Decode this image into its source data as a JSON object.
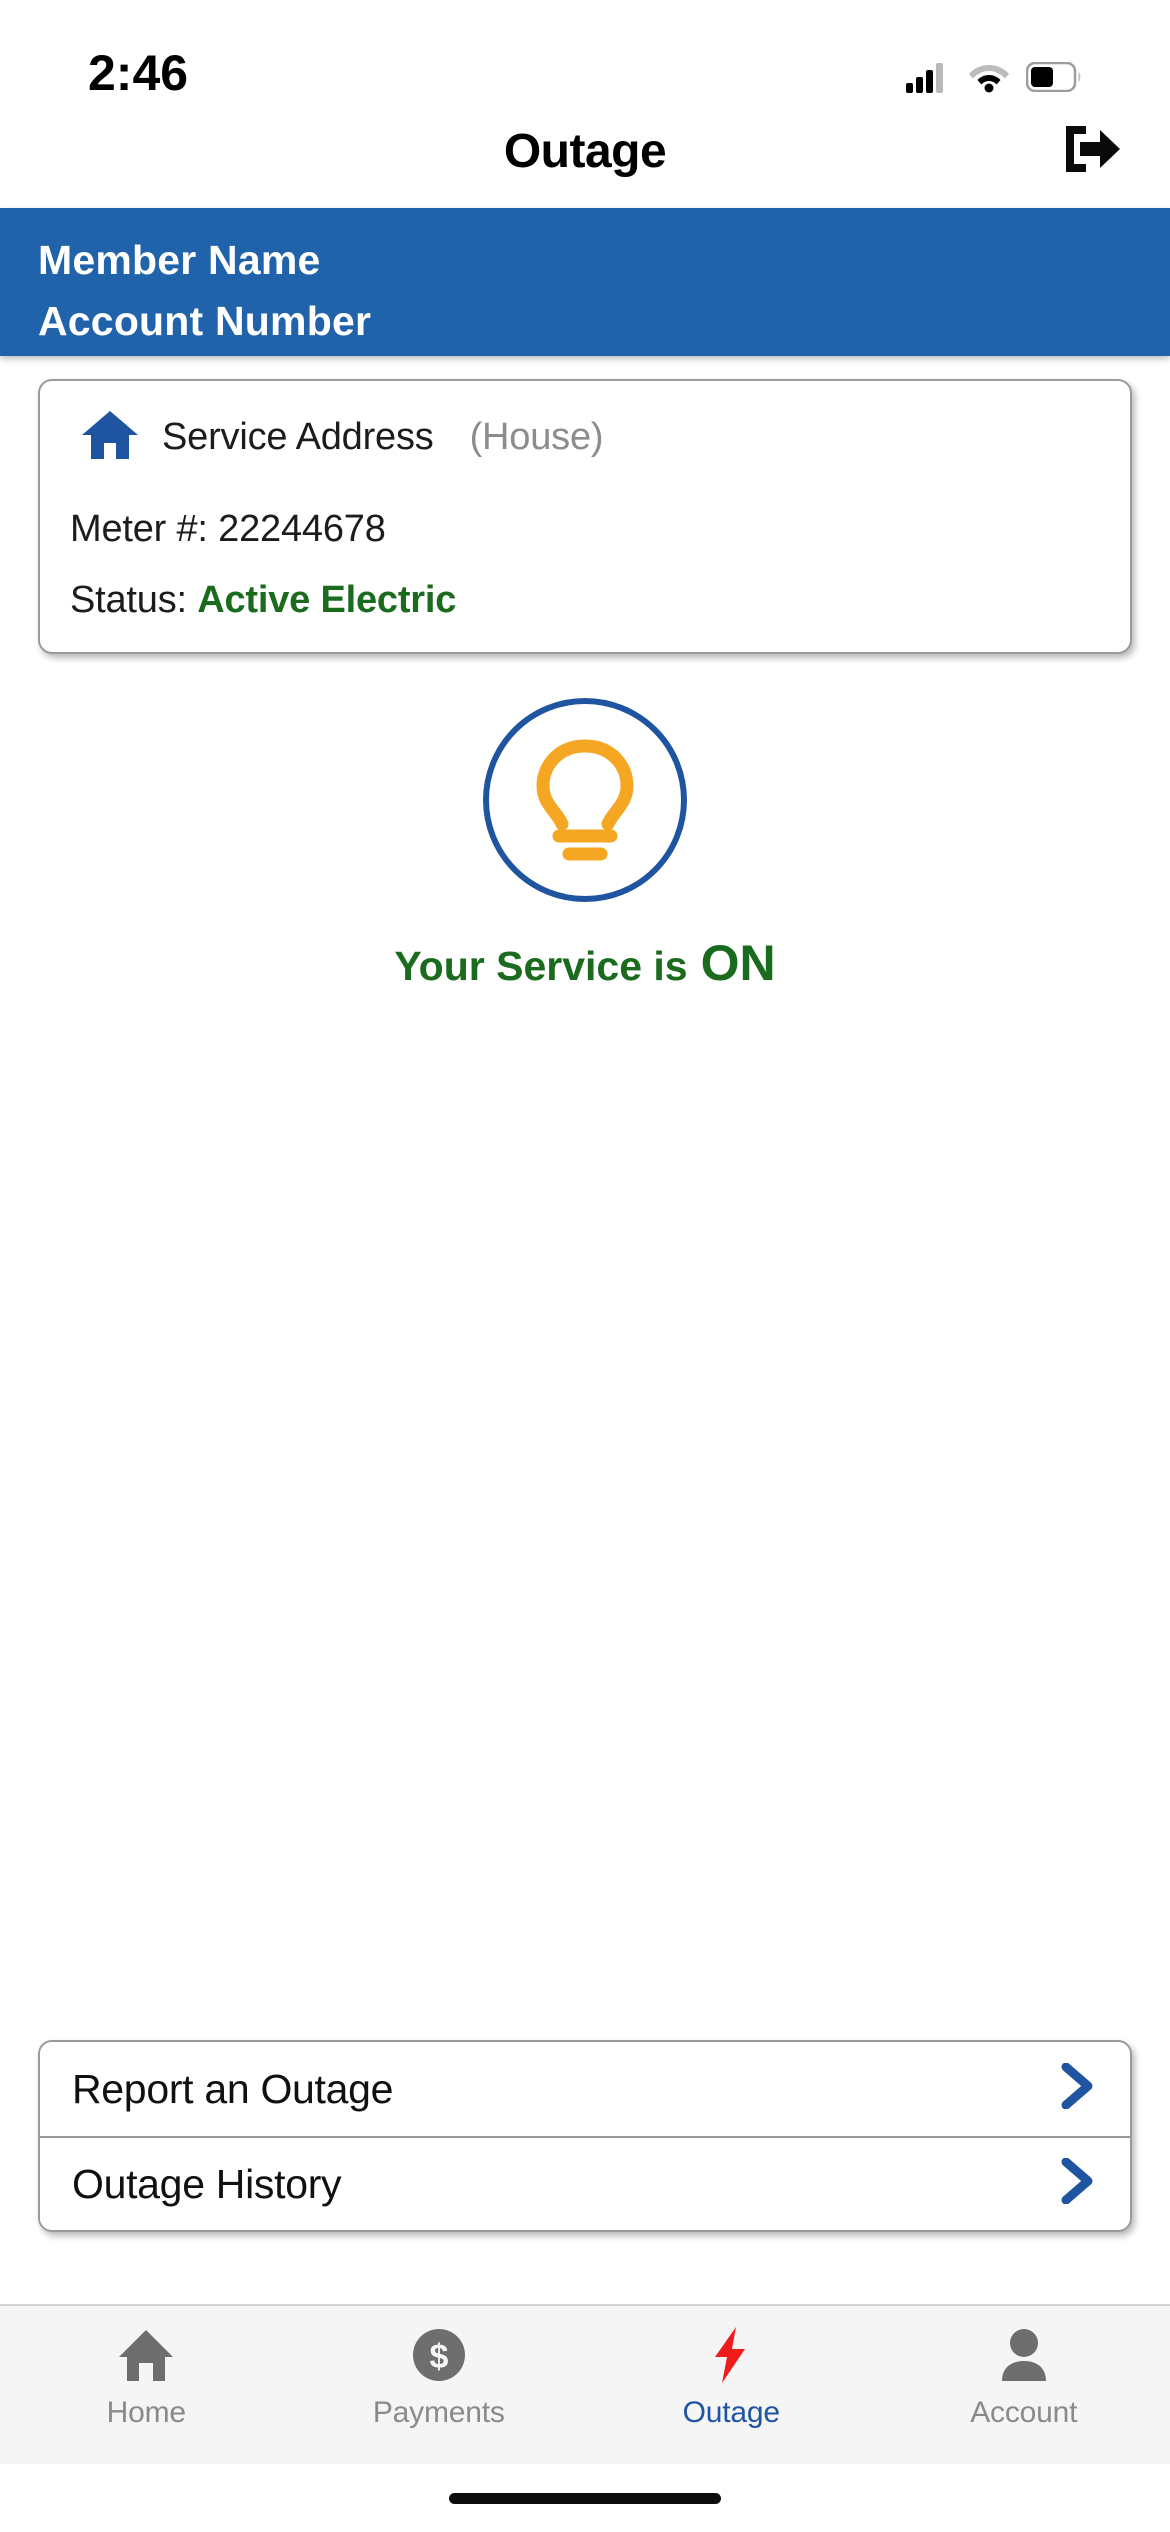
{
  "status_bar": {
    "time": "2:46",
    "cellular_icon": "cellular-signal-icon",
    "wifi_icon": "wifi-icon",
    "battery_icon": "battery-icon"
  },
  "header": {
    "title": "Outage",
    "logout_icon": "logout-icon"
  },
  "account_banner": {
    "member_name": "Member Name",
    "account_number": "Account Number",
    "background_color": "#2163ab",
    "text_color": "#ffffff"
  },
  "service_card": {
    "home_icon": "home-icon",
    "address_label": "Service Address",
    "address_type": "(House)",
    "meter_label": "Meter #:",
    "meter_value": "22244678",
    "status_label": "Status:",
    "status_value": "Active Electric",
    "status_color": "#1a6b1e"
  },
  "service_indicator": {
    "bulb_icon": "lightbulb-icon",
    "bulb_color": "#f5a623",
    "circle_color": "#1f54a0",
    "status_prefix": "Your Service is",
    "status_state": "ON",
    "status_color": "#1a6b1e"
  },
  "actions": [
    {
      "label": "Report an Outage",
      "chevron": "chevron-right-icon"
    },
    {
      "label": "Outage History",
      "chevron": "chevron-right-icon"
    }
  ],
  "tabs": [
    {
      "label": "Home",
      "icon": "home-icon",
      "active": false,
      "color": "#8a8a8a"
    },
    {
      "label": "Payments",
      "icon": "dollar-coin-icon",
      "active": false,
      "color": "#8a8a8a"
    },
    {
      "label": "Outage",
      "icon": "lightning-bolt-icon",
      "active": true,
      "color": "#1f54a0"
    },
    {
      "label": "Account",
      "icon": "person-icon",
      "active": false,
      "color": "#8a8a8a"
    }
  ]
}
